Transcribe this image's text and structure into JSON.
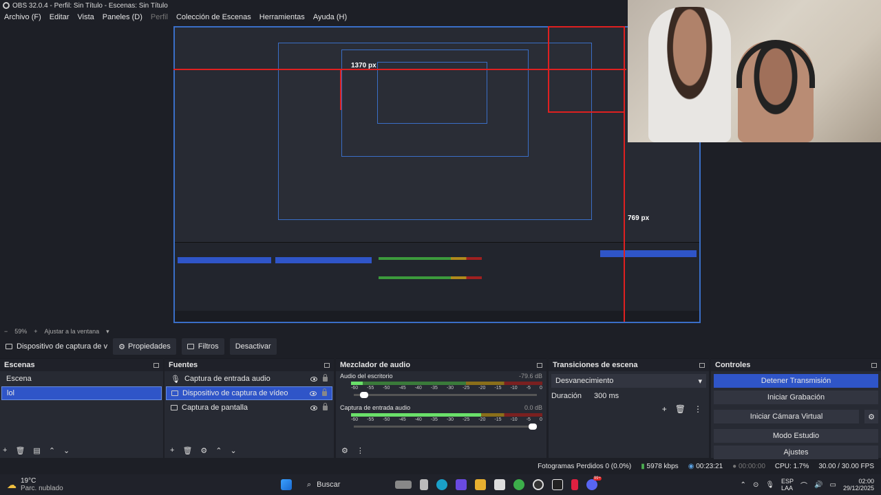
{
  "window": {
    "title": "OBS 32.0.4 - Perfil: Sin Título - Escenas: Sin Título"
  },
  "menu": [
    "Archivo (F)",
    "Editar",
    "Vista",
    "Paneles (D)",
    "Perfil",
    "Colección de Escenas",
    "Herramientas",
    "Ayuda (H)"
  ],
  "preview": {
    "label_top": "1370 px",
    "label_right": "769 px",
    "label_mid": "1370 px",
    "label_mid2": "769 px"
  },
  "zoom": {
    "level": "59%",
    "fit": "Ajustar a la ventana",
    "minus": "−",
    "plus": "+"
  },
  "source_toolbar": {
    "source_name": "Dispositivo de captura de v",
    "properties": "Propiedades",
    "filters": "Filtros",
    "deactivate": "Desactivar"
  },
  "scenes": {
    "title": "Escenas",
    "items": [
      "Escena",
      "lol"
    ],
    "selected_index": 1
  },
  "sources": {
    "title": "Fuentes",
    "items": [
      {
        "label": "Captura de entrada audio",
        "icon": "microphone-icon"
      },
      {
        "label": "Dispositivo de captura de vídeo",
        "icon": "camera-icon"
      },
      {
        "label": "Captura de pantalla",
        "icon": "monitor-icon"
      }
    ],
    "selected_index": 1
  },
  "mixer": {
    "title": "Mezclador de audio",
    "channels": [
      {
        "name": "Audio del escritorio",
        "db": "-79.6 dB",
        "level": 0.06,
        "volume": 0.08
      },
      {
        "name": "Captura de entrada audio",
        "db": "0.0 dB",
        "level": 0.68,
        "volume": 1.0
      }
    ],
    "scale": [
      "-60",
      "-55",
      "-50",
      "-45",
      "-40",
      "-35",
      "-30",
      "-25",
      "-20",
      "-15",
      "-10",
      "-5",
      "0"
    ]
  },
  "transitions": {
    "title": "Transiciones de escena",
    "selected": "Desvanecimiento",
    "duration_label": "Duración",
    "duration_value": "300 ms"
  },
  "controls": {
    "title": "Controles",
    "buttons": [
      "Detener Transmisión",
      "Iniciar Grabación",
      "Iniciar Cámara Virtual",
      "Modo Estudio",
      "Ajustes"
    ]
  },
  "status": {
    "dropped": "Fotogramas Perdidos 0 (0.0%)",
    "bitrate": "5978 kbps",
    "stream_time": "00:23:21",
    "rec_time": "00:00:00",
    "cpu": "CPU: 1.7%",
    "fps": "30.00 / 30.00 FPS"
  },
  "taskbar": {
    "weather_temp": "19°C",
    "weather_desc": "Parc. nublado",
    "search": "Buscar",
    "lang": "ESP",
    "lang2": "LAA",
    "time": "02:00",
    "date": "29/12/2025",
    "badge": "99+"
  },
  "colors": {
    "accent": "#2f55c8",
    "bg": "#1d1f26",
    "dock": "#272a33",
    "red": "#e02020"
  }
}
